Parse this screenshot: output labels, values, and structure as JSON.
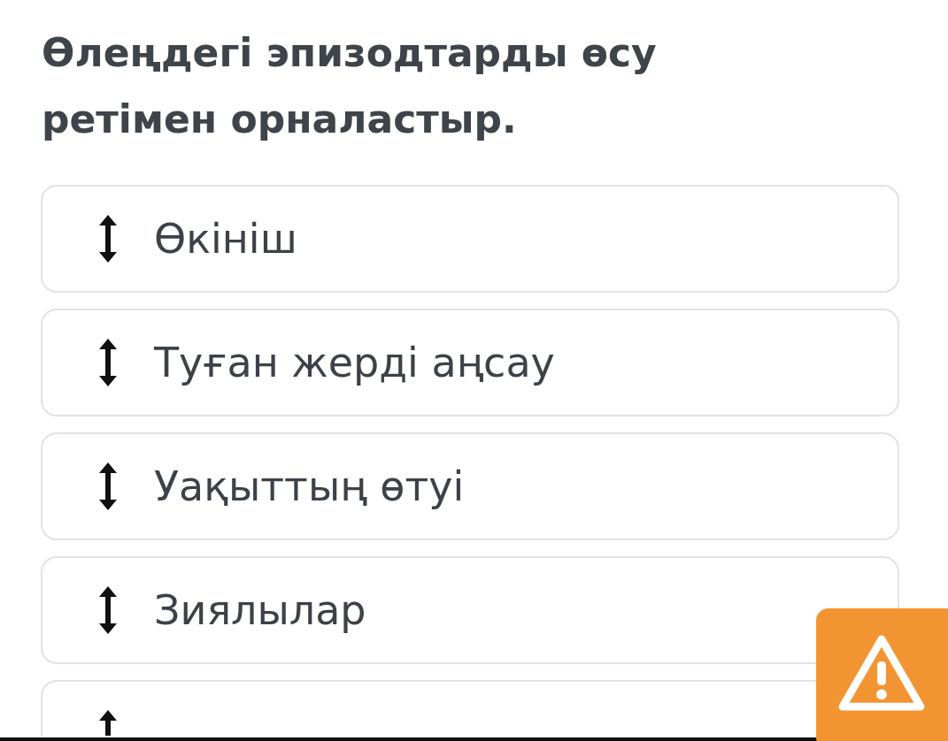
{
  "question": {
    "title": "Өлеңдегі эпизодтарды өсу ретімен орналастыр."
  },
  "items": [
    {
      "label": "Өкініш"
    },
    {
      "label": "Туған жерді аңсау"
    },
    {
      "label": "Уақыттың өтуі"
    },
    {
      "label": "Зиялылар"
    },
    {
      "kind": "cut"
    }
  ],
  "report_button": {
    "kind": "warning"
  }
}
